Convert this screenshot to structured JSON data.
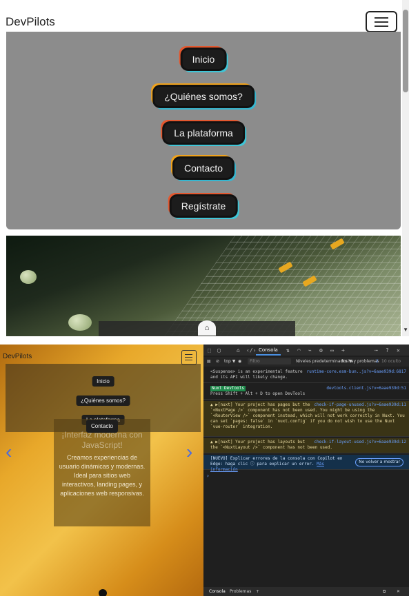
{
  "top": {
    "brand": "DevPilots",
    "menu": [
      "Inicio",
      "¿Quiénes somos?",
      "La plataforma",
      "Contacto",
      "Regístrate"
    ]
  },
  "bottom_page": {
    "brand": "DevPilots",
    "menu": [
      "Inicio",
      "¿Quiénes somos?",
      "La plataforma",
      "Contacto"
    ],
    "card_title": "¡Interfaz moderna con JavaScript!",
    "card_body": "Creamos experiencias de usuario dinámicas y modernas. Ideal para sitios web interactivos, landing pages, y aplicaciones web responsivas."
  },
  "devtools": {
    "tab_console": "Consola",
    "context": "top ▼",
    "filter_placeholder": "Filtro",
    "levels": "Niveles predeterminados ▼",
    "problems": "No hay problemas",
    "problems_count": "2",
    "hidden": "10 oculto",
    "messages": {
      "m1_text": "<Suspense> is an experimental feature and its API will likely change.",
      "m1_src": "runtime-core.esm-bun..js?v=6aae939d:6817",
      "m2_tag": "Nuxt DevTools",
      "m2_src": "devtools.client.js?v=6aae939d:51",
      "m2_text": "Press Shift + Alt + D to open DevTools",
      "m3_text": "▲ ▶[nuxt] Your project has pages but the `<NuxtPage />` component has not been used. You might be using the `<RouterView />` component instead, which will not work correctly in Nuxt. You can set `pages: false` in `nuxt.config` if you do not wish to use the Nuxt `vue-router` integration.",
      "m3_src": "check-if-page-unused.js?v=6aae939d:11",
      "m4_text": "▲ ▶[nuxt] Your project has layouts but the `<NuxtLayout />` component has not been used.",
      "m4_src": "check-if-layout-used.js?v=6aae939d:12",
      "m5_text": "[NUEVO] Explicar errores de la consola con Copilot en Edge: haga clic ⓘ para explicar un error.",
      "m5_link": "Más información",
      "m5_button": "No volver a mostrar"
    },
    "footer_tab1": "Consola",
    "footer_tab2": "Problemas",
    "footer_add": "+"
  },
  "colors": {
    "accent_blue": "#4a90e2",
    "warn_bg": "#3a3416",
    "menu_panel": "#8c8c8c"
  }
}
